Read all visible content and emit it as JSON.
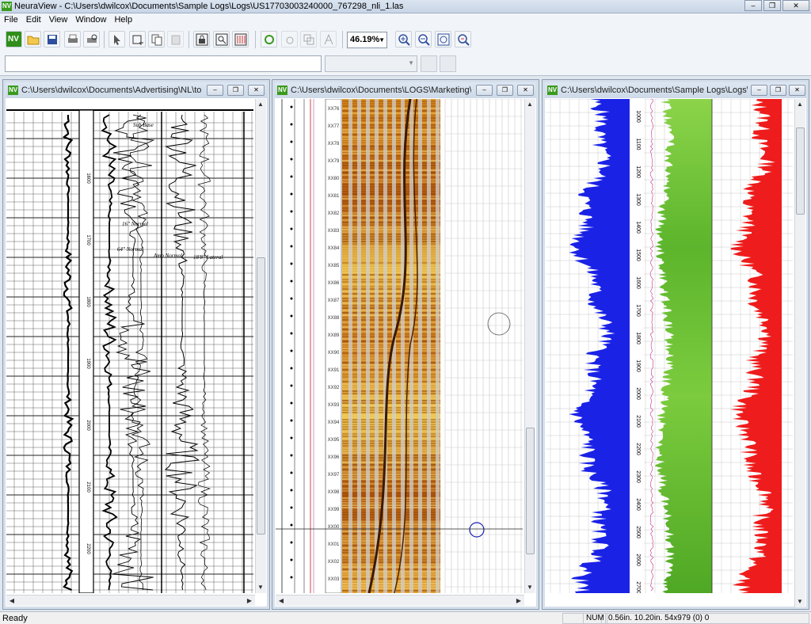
{
  "app": {
    "title": "NeuraView - C:\\Users\\dwilcox\\Documents\\Sample Logs\\Logs\\US17703003240000_767298_nli_1.las",
    "logo": "NV"
  },
  "menu": [
    "File",
    "Edit",
    "View",
    "Window",
    "Help"
  ],
  "toolbar": {
    "icons": [
      "new-nv-icon",
      "open-folder-icon",
      "save-icon",
      "print-icon",
      "print-preview-icon",
      "pointer-icon",
      "select-region-icon",
      "copy-icon",
      "paste-icon",
      "lock-icon",
      "zoom-page-icon",
      "track-layout-icon",
      "refresh-icon",
      "rotate-icon",
      "overlay-icon",
      "well-icon",
      "zoom-in-icon",
      "zoom-out-icon",
      "zoom-fit-icon",
      "zoom-reset-icon"
    ],
    "zoom_value": "46.19%"
  },
  "windows": [
    {
      "title": "C:\\Users\\dwilcox\\Documents\\Advertising\\NL\\top o..."
    },
    {
      "title": "C:\\Users\\dwilcox\\Documents\\LOGS\\Marketing\\NZ..."
    },
    {
      "title": "C:\\Users\\dwilcox\\Documents\\Sample Logs\\Logs\\US..."
    }
  ],
  "raster_log": {
    "annotations": [
      "Sub Base",
      "16\" Normal",
      "64\" Normal",
      "Amp Normal",
      "18'8\" Lateral"
    ],
    "depth_labels": [
      "1600",
      "1700",
      "1800",
      "1900",
      "2000",
      "2100",
      "2200"
    ]
  },
  "image_log": {
    "depth_labels": [
      "XX76",
      "XX77",
      "XX78",
      "XX79",
      "XX80",
      "XX81",
      "XX82",
      "XX83",
      "XX84",
      "XX85",
      "XX86",
      "XX87",
      "XX88",
      "XX89",
      "XX90",
      "XX91",
      "XX92",
      "XX93",
      "XX94",
      "XX95",
      "XX96",
      "XX97",
      "XX98",
      "XX99",
      "XX00",
      "XX01",
      "XX02",
      "XX03"
    ]
  },
  "las_log": {
    "depth_labels": [
      "1000",
      "1100",
      "1200",
      "1300",
      "1400",
      "1500",
      "1600",
      "1700",
      "1800",
      "1900",
      "2000",
      "2100",
      "2200",
      "2300",
      "2400",
      "2500",
      "2600",
      "2700"
    ],
    "colors": {
      "blue": "#1a22e6",
      "green": "#5bbf2a",
      "red": "#ee1c1c"
    }
  },
  "status": {
    "ready": "Ready",
    "num": "NUM",
    "coords": "0.56in. 10.20in. 54x979 (0) 0"
  }
}
